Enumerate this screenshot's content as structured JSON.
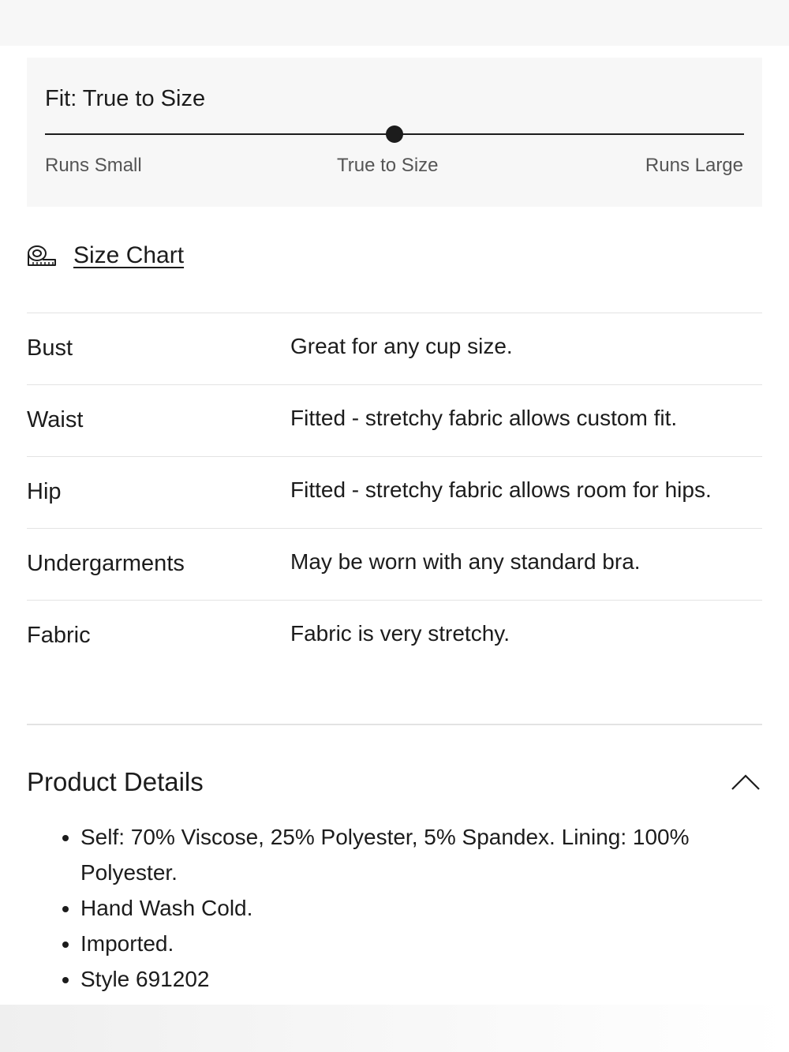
{
  "fit": {
    "title": "Fit: True to Size",
    "level": 0.5,
    "scale_left": "Runs Small",
    "scale_mid": "True to Size",
    "scale_right": "Runs Large"
  },
  "size_chart": {
    "icon": "measuring-tape-icon",
    "label": "Size Chart"
  },
  "fit_rows": [
    {
      "label": "Bust",
      "value": "Great for any cup size."
    },
    {
      "label": "Waist",
      "value": "Fitted - stretchy fabric allows custom fit."
    },
    {
      "label": "Hip",
      "value": "Fitted - stretchy fabric allows room for hips."
    },
    {
      "label": "Undergarments",
      "value": "May be worn with any standard bra."
    },
    {
      "label": "Fabric",
      "value": "Fabric is very stretchy."
    }
  ],
  "product_details": {
    "title": "Product Details",
    "toggle_icon": "chevron-up-icon",
    "items": [
      "Self: 70% Viscose, 25% Polyester, 5% Spandex. Lining: 100% Polyester.",
      "Hand Wash Cold.",
      "Imported.",
      "Style 691202"
    ]
  },
  "colors": {
    "text": "#1c1c1c",
    "muted": "#555555",
    "card_bg": "#f7f7f7",
    "divider": "#e3e3e3"
  }
}
